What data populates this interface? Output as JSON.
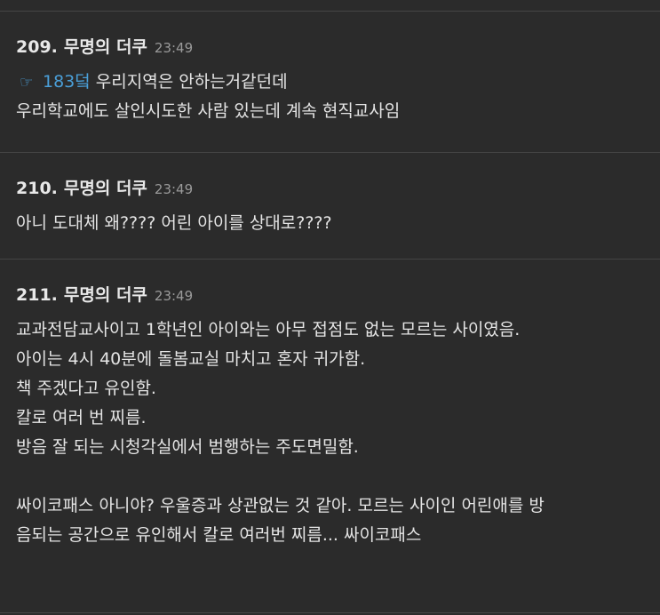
{
  "comments": [
    {
      "number": "209.",
      "nickname": "무명의 더쿠",
      "time": "23:49",
      "reply_icon": "☞",
      "reply_ref": "183덬",
      "lines": [
        "우리지역은 안하는거같던데",
        "우리학교에도 살인시도한 사람 있는데 계속 현직교사임"
      ]
    },
    {
      "number": "210.",
      "nickname": "무명의 더쿠",
      "time": "23:49",
      "lines": [
        "아니 도대체 왜???? 어린 아이를 상대로????"
      ]
    },
    {
      "number": "211.",
      "nickname": "무명의 더쿠",
      "time": "23:49",
      "lines": [
        "교과전담교사이고 1학년인 아이와는 아무 접점도 없는 모르는 사이였음.",
        "아이는 4시 40분에 돌봄교실 마치고 혼자 귀가함.",
        "책 주겠다고 유인함.",
        "칼로 여러 번 찌름.",
        "방음 잘 되는 시청각실에서 범행하는 주도면밀함.",
        "싸이코패스 아니야? 우울증과 상관없는 것 같아. 모르는 사이인 어린애를 방",
        "음되는 공간으로 유인해서 칼로 여러번 찌름... 싸이코패스"
      ]
    }
  ]
}
